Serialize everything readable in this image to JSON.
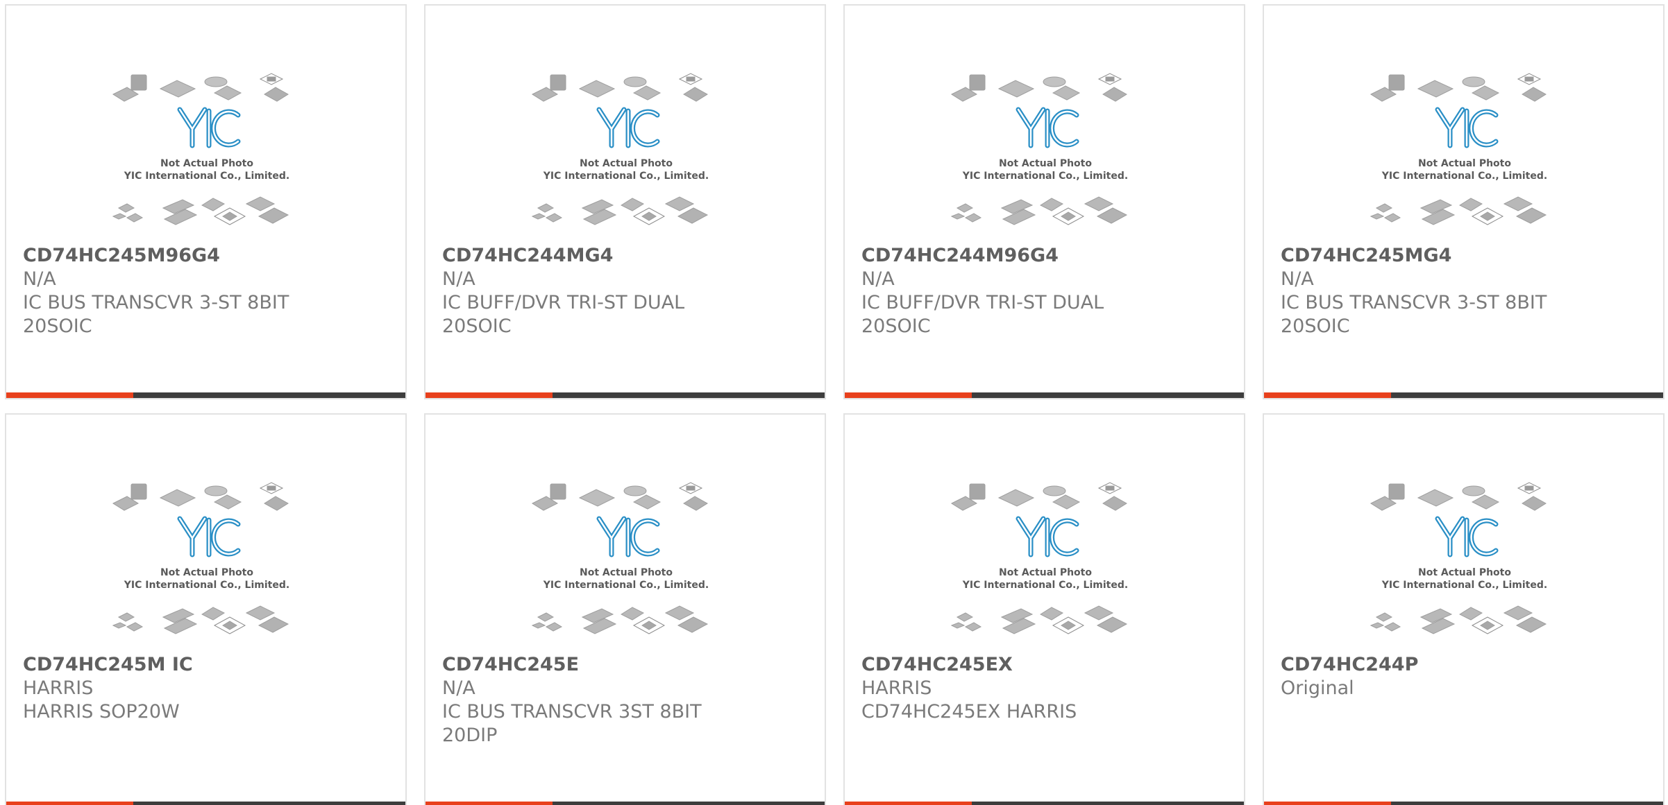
{
  "theme": {
    "accent_color": "#e8401c",
    "bar_color": "#3d3d3d",
    "logo_color": "#2a8fc6"
  },
  "photo": {
    "logo_text": "YIC",
    "caption_line1": "Not Actual Photo",
    "caption_line2": "YIC International Co., Limited."
  },
  "products": [
    {
      "part": "CD74HC245M96G4",
      "lines": [
        "N/A",
        "IC BUS TRANSCVR 3-ST 8BIT",
        "20SOIC"
      ]
    },
    {
      "part": "CD74HC244MG4",
      "lines": [
        "N/A",
        "IC BUFF/DVR TRI-ST DUAL",
        "20SOIC"
      ]
    },
    {
      "part": "CD74HC244M96G4",
      "lines": [
        "N/A",
        "IC BUFF/DVR TRI-ST DUAL",
        "20SOIC"
      ]
    },
    {
      "part": "CD74HC245MG4",
      "lines": [
        "N/A",
        "IC BUS TRANSCVR 3-ST 8BIT",
        "20SOIC"
      ]
    },
    {
      "part": "CD74HC245M IC",
      "lines": [
        "HARRIS",
        "HARRIS SOP20W"
      ]
    },
    {
      "part": "CD74HC245E",
      "lines": [
        "N/A",
        "IC BUS TRANSCVR 3ST 8BIT",
        "20DIP"
      ]
    },
    {
      "part": "CD74HC245EX",
      "lines": [
        "HARRIS",
        "CD74HC245EX HARRIS"
      ]
    },
    {
      "part": "CD74HC244P",
      "lines": [
        "Original"
      ]
    }
  ]
}
